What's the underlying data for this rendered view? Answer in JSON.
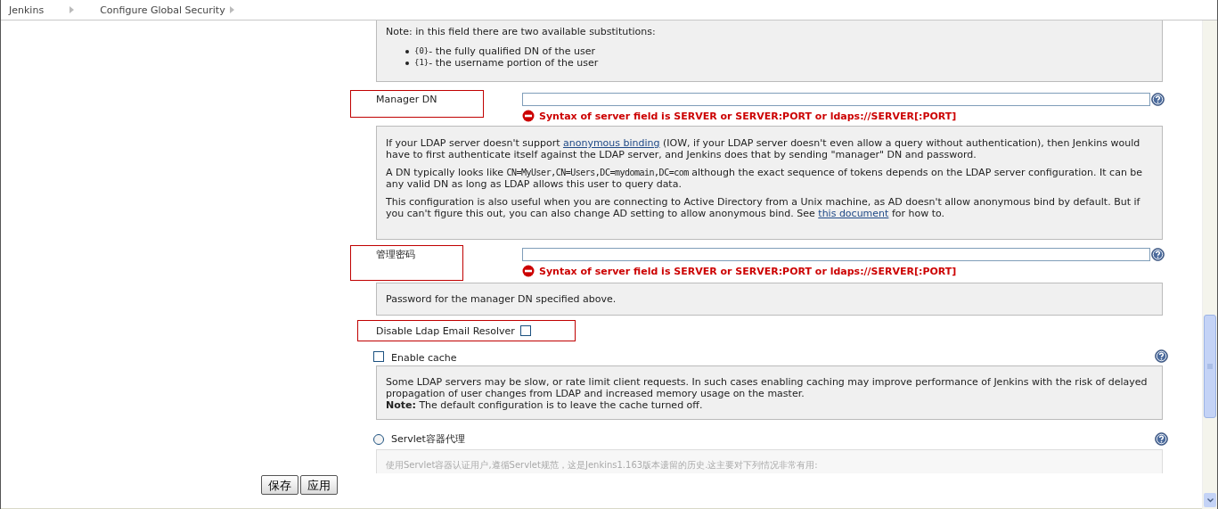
{
  "breadcrumbs": [
    "Jenkins",
    "Configure Global Security"
  ],
  "note_box": {
    "text": "Note: in this field there are two available substitutions:",
    "items": [
      {
        "code": "{0}",
        "text": " - the fully qualified DN of the user"
      },
      {
        "code": "{1}",
        "text": " - the username portion of the user"
      }
    ]
  },
  "fields": [
    {
      "label": "Manager DN",
      "error": "Syntax of server field is SERVER or SERVER:PORT or ldaps://SERVER[:PORT]",
      "help": [
        [
          {
            "kind": "text",
            "text": "If your LDAP server doesn't support "
          },
          {
            "kind": "link",
            "text": "anonymous binding"
          },
          {
            "kind": "text",
            "text": " (IOW, if your LDAP server doesn't even allow a query without authentication), then Jenkins would have to first authenticate itself against the LDAP server, and Jenkins does that by sending \"manager\" DN and password."
          }
        ],
        [
          {
            "kind": "text",
            "text": "A DN typically looks like "
          },
          {
            "kind": "code",
            "text": "CN=MyUser,CN=Users,DC=mydomain,DC=com"
          },
          {
            "kind": "text",
            "text": " although the exact sequence of tokens depends on the LDAP server configuration. It can be any valid DN as long as LDAP allows this user to query data."
          }
        ],
        [
          {
            "kind": "text",
            "text": "This configuration is also useful when you are connecting to Active Directory from a Unix machine, as AD doesn't allow anonymous bind by default. But if you can't figure this out, you can also change AD setting to allow anonymous bind. See "
          },
          {
            "kind": "link",
            "text": "this document"
          },
          {
            "kind": "text",
            "text": " for how to."
          }
        ]
      ]
    },
    {
      "label": "管理密码",
      "error": "Syntax of server field is SERVER or SERVER:PORT or ldaps://SERVER[:PORT]",
      "help": [
        [
          {
            "kind": "text",
            "text": "Password for the manager DN specified above."
          }
        ]
      ]
    }
  ],
  "disable_resolver": {
    "label": "Disable Ldap Email Resolver",
    "checked": false
  },
  "enable_cache": {
    "label": "Enable cache",
    "checked": false,
    "help": [
      "Some LDAP servers may be slow, or rate limit client requests. In such cases enabling caching may improve performance of Jenkins with the risk of delayed propagation of user changes from LDAP and increased memory usage on the master.",
      "**Note:** The default configuration is to leave the cache turned off."
    ]
  },
  "servlet": {
    "label": "Servlet容器代理",
    "selected": false,
    "help": "使用Servlet容器认证用户,遵循Servlet规范，这是Jenkins1.163版本遗留的历史.这主要对下列情况非常有用:"
  },
  "buttons": [
    "保存",
    "应用"
  ]
}
